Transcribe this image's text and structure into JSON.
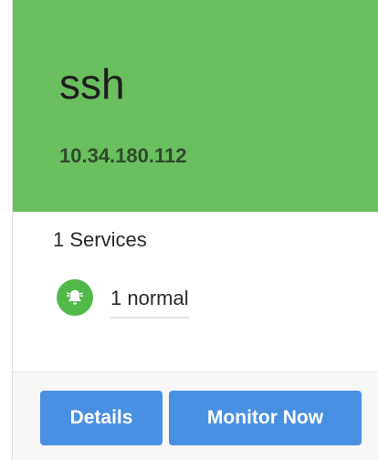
{
  "host": {
    "name": "ssh",
    "ip": "10.34.180.112",
    "status_color": "#6abf5e"
  },
  "summary": {
    "services": "1 Services",
    "alert_icon": "bell-icon",
    "alert_label": "1 normal",
    "alert_color": "#52b84a"
  },
  "actions": {
    "details_label": "Details",
    "monitor_label": "Monitor Now",
    "button_color": "#4a90e2"
  }
}
